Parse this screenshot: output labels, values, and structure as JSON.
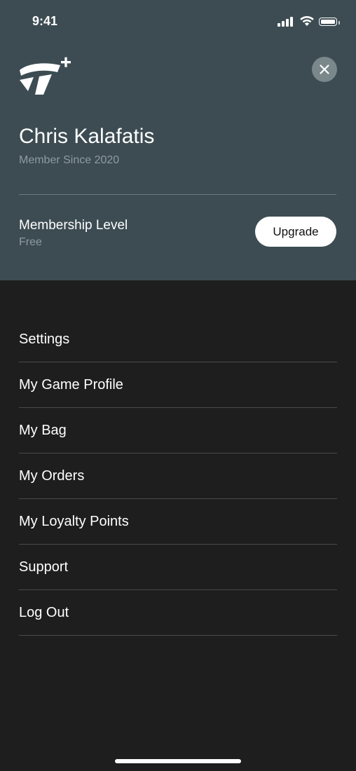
{
  "status_bar": {
    "time": "9:41"
  },
  "profile": {
    "name": "Chris Kalafatis",
    "member_since": "Member Since 2020",
    "membership_label": "Membership Level",
    "membership_value": "Free",
    "upgrade_label": "Upgrade"
  },
  "menu": {
    "items": [
      {
        "label": "Settings"
      },
      {
        "label": "My Game Profile"
      },
      {
        "label": "My Bag"
      },
      {
        "label": "My Orders"
      },
      {
        "label": "My Loyalty Points"
      },
      {
        "label": "Support"
      },
      {
        "label": "Log Out"
      }
    ]
  },
  "icons": {
    "logo": "taylormade-plus-logo",
    "close": "close-icon"
  },
  "colors": {
    "header_bg": "#3c4c52",
    "body_bg": "#1e1e1e",
    "muted_text": "#8f9ba0",
    "close_bg": "#7a878b"
  }
}
